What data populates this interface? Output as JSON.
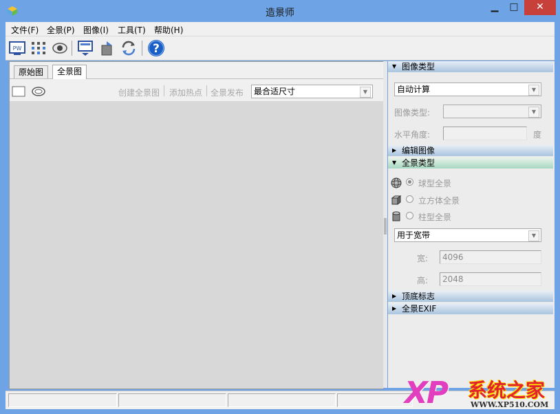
{
  "window": {
    "title": "造景师",
    "controls": {
      "minimize": "▁",
      "maximize": "□",
      "close": "✕"
    }
  },
  "menu": [
    {
      "label": "文件(F)"
    },
    {
      "label": "全景(P)"
    },
    {
      "label": "图像(I)"
    },
    {
      "label": "工具(T)"
    },
    {
      "label": "帮助(H)"
    }
  ],
  "toolbar": {
    "icons": [
      "pw-view-icon",
      "stitch-settings-icon",
      "preview-eye-icon",
      "publish-icon",
      "export-icon",
      "sync-icon",
      "help-icon"
    ],
    "help_glyph": "?",
    "pw_glyph": "PW"
  },
  "tabs": [
    {
      "label": "原始图",
      "active": false
    },
    {
      "label": "全景图",
      "active": true
    }
  ],
  "sub_toolbar": {
    "links": [
      "创建全景图",
      "添加热点",
      "全景发布"
    ],
    "view_mode": "最合适尺寸"
  },
  "right_panel": {
    "image_type_section": {
      "title": "图像类型",
      "mode": "自动计算",
      "image_type_label": "图像类型:",
      "image_type_value": "",
      "horizontal_angle_label": "水平角度:",
      "horizontal_angle_value": "",
      "angle_unit": "度"
    },
    "edit_image_section": {
      "title": "编辑图像"
    },
    "panorama_type_section": {
      "title": "全景类型",
      "options": [
        {
          "label": "球型全景",
          "selected": true,
          "icon": "sphere-icon"
        },
        {
          "label": "立方体全景",
          "selected": false,
          "icon": "cube-icon"
        },
        {
          "label": "柱型全景",
          "selected": false,
          "icon": "cylinder-icon"
        }
      ],
      "usage": "用于宽带",
      "width_label": "宽:",
      "width_value": "4096",
      "height_label": "高:",
      "height_value": "2048"
    },
    "top_bottom_section": {
      "title": "顶底标志"
    },
    "exif_section": {
      "title": "全景EXIF"
    }
  },
  "watermark": {
    "brand_xp": "XP",
    "brand_cn": "系统之家",
    "url": "WWW.XP510.COM"
  },
  "colors": {
    "titlebar": "#6ea4e6",
    "close_button": "#c7413a",
    "section_header": "#a9c4de",
    "section_header_active": "#a6d8c2",
    "help_icon": "#1a5fc8"
  }
}
